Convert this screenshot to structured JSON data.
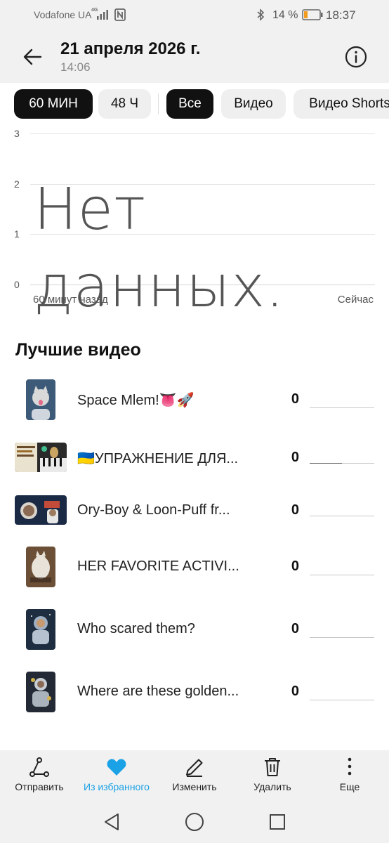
{
  "status_bar": {
    "carrier": "Vodafone UA",
    "network": "4G",
    "battery_percent": "14 %",
    "time": "18:37"
  },
  "header": {
    "title": "21 апреля 2026 г.",
    "subtitle": "14:06"
  },
  "filters": {
    "time_ranges": [
      {
        "label": "60 МИН",
        "selected": true
      },
      {
        "label": "48 Ч",
        "selected": false
      }
    ],
    "types": [
      {
        "label": "Все",
        "selected": true
      },
      {
        "label": "Видео",
        "selected": false
      },
      {
        "label": "Видео Shorts",
        "selected": false
      }
    ]
  },
  "chart_data": {
    "type": "bar",
    "y_ticks": [
      "3",
      "2",
      "1",
      "0"
    ],
    "ylim": [
      0,
      3
    ],
    "x_start_label": "60 минут назад",
    "x_end_label": "Сейчас",
    "empty_message": "Нет данных.",
    "values": []
  },
  "top_videos": {
    "title": "Лучшие видео",
    "items": [
      {
        "title": "Space Mlem!👅🚀",
        "count": "0",
        "thumb_type": "portrait",
        "colors": [
          "#3d5a78",
          "#d9d9d9"
        ]
      },
      {
        "title": "🇺🇦УПРАЖНЕНИЕ ДЛЯ...",
        "count": "0",
        "thumb_type": "landscape",
        "colors": [
          "#2a2a2a",
          "#c9a463"
        ],
        "progress": 0.5
      },
      {
        "title": "Ory-Boy & Loon-Puff fr...",
        "count": "0",
        "thumb_type": "landscape",
        "colors": [
          "#1b2a44",
          "#c24b3a"
        ]
      },
      {
        "title": "HER FAVORITE ACTIVI...",
        "count": "0",
        "thumb_type": "portrait",
        "colors": [
          "#6b4f36",
          "#e8e2d8"
        ]
      },
      {
        "title": "Who scared them?",
        "count": "0",
        "thumb_type": "portrait",
        "colors": [
          "#1e2d3f",
          "#9fb0c4"
        ]
      },
      {
        "title": "Where are these golden...",
        "count": "0",
        "thumb_type": "portrait",
        "colors": [
          "#232a35",
          "#c8cdd4"
        ]
      }
    ]
  },
  "actions": [
    {
      "label": "Отправить",
      "icon": "share-icon"
    },
    {
      "label": "Из избранного",
      "icon": "heart-icon",
      "color": "#1aa1e6"
    },
    {
      "label": "Изменить",
      "icon": "pencil-icon"
    },
    {
      "label": "Удалить",
      "icon": "trash-icon"
    },
    {
      "label": "Еще",
      "icon": "more-vertical-icon"
    }
  ],
  "nav": [
    "back-triangle-icon",
    "home-circle-icon",
    "recents-square-icon"
  ]
}
